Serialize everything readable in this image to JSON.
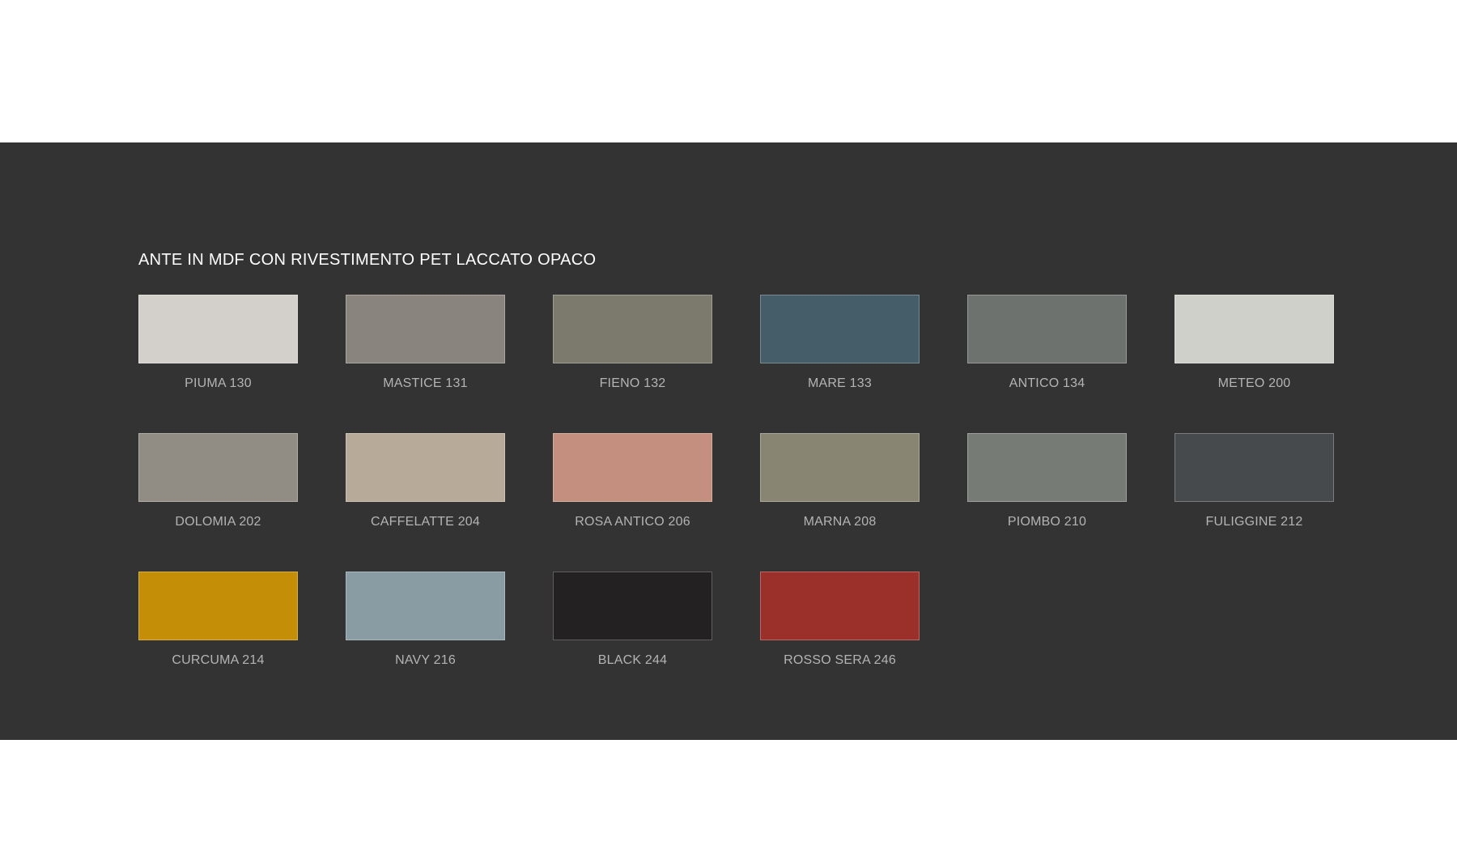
{
  "section": {
    "title": "ANTE IN MDF CON RIVESTIMENTO PET LACCATO OPACO"
  },
  "colors": [
    {
      "name": "PIUMA 130",
      "hex": "#d3d0cb"
    },
    {
      "name": "MASTICE 131",
      "hex": "#89857e"
    },
    {
      "name": "FIENO 132",
      "hex": "#7c7a6d"
    },
    {
      "name": "MARE 133",
      "hex": "#455c69"
    },
    {
      "name": "ANTICO 134",
      "hex": "#6d726f"
    },
    {
      "name": "METEO 200",
      "hex": "#d0d0cb"
    },
    {
      "name": "DOLOMIA 202",
      "hex": "#918d84"
    },
    {
      "name": "CAFFELATTE 204",
      "hex": "#b8aa98"
    },
    {
      "name": "ROSA ANTICO 206",
      "hex": "#c58f7f"
    },
    {
      "name": "MARNA 208",
      "hex": "#888572"
    },
    {
      "name": "PIOMBO 210",
      "hex": "#777b75"
    },
    {
      "name": "FULIGGINE 212",
      "hex": "#474a4c"
    },
    {
      "name": "CURCUMA 214",
      "hex": "#c48f06"
    },
    {
      "name": "NAVY 216",
      "hex": "#8a9ca3"
    },
    {
      "name": "BLACK 244",
      "hex": "#242122"
    },
    {
      "name": "ROSSO SERA 246",
      "hex": "#9b302b"
    }
  ]
}
